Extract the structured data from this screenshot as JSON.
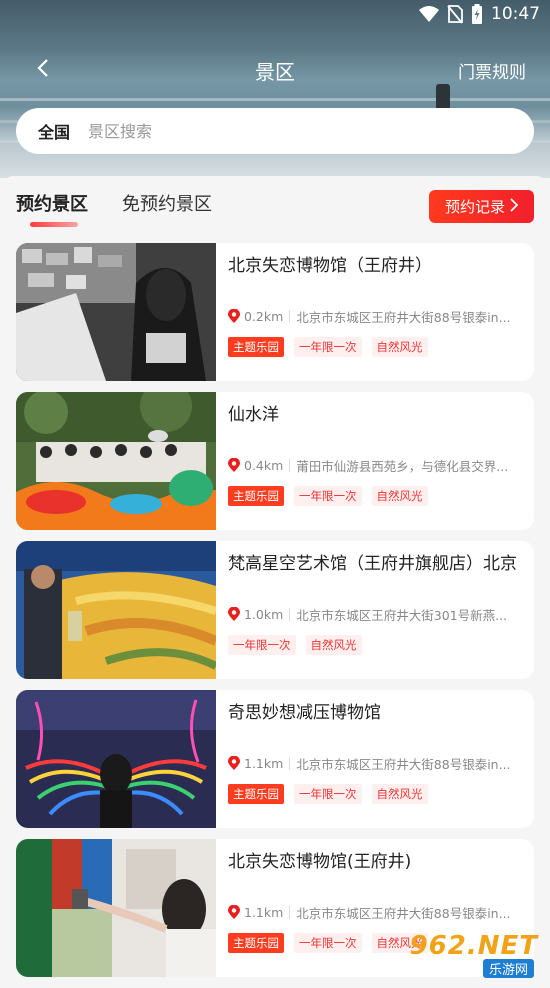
{
  "status_bar": {
    "time": "10:47",
    "icons": [
      "wifi-icon",
      "no-sim-icon",
      "battery-charging-icon"
    ]
  },
  "navbar": {
    "title": "景区",
    "right_link": "门票规则"
  },
  "search": {
    "region": "全国",
    "placeholder": "景区搜索"
  },
  "tabs": {
    "active": "预约景区",
    "inactive": "免预约景区"
  },
  "record_button": "预约记录",
  "spots": [
    {
      "name": "北京失恋博物馆（王府井）",
      "distance": "0.2km",
      "address": "北京市东城区王府井大街88号银泰in...",
      "tags": [
        "主题乐园",
        "一年限一次",
        "自然风光"
      ]
    },
    {
      "name": "仙水洋",
      "distance": "0.4km",
      "address": "莆田市仙游县西苑乡，与德化县交界...",
      "tags": [
        "主题乐园",
        "一年限一次",
        "自然风光"
      ]
    },
    {
      "name": "梵高星空艺术馆（王府井旗舰店）北京",
      "distance": "1.0km",
      "address": "北京市东城区王府井大街301号新燕...",
      "tags": [
        "一年限一次",
        "自然风光"
      ]
    },
    {
      "name": "奇思妙想减压博物馆",
      "distance": "1.1km",
      "address": "北京市东城区王府井大街88号银泰in...",
      "tags": [
        "主题乐园",
        "一年限一次",
        "自然风光"
      ]
    },
    {
      "name": "北京失恋博物馆(王府井)",
      "distance": "1.1km",
      "address": "北京市东城区王府井大街88号银泰in...",
      "tags": [
        "主题乐园",
        "一年限一次",
        "自然风光"
      ]
    }
  ],
  "watermark": {
    "text": "962.NET",
    "sub": "乐游网"
  },
  "colors": {
    "accent": "#f2202b",
    "tag_fill": "#ff3c1f",
    "tag_soft_bg": "#fff0ef",
    "tag_soft_text": "#e33333"
  }
}
